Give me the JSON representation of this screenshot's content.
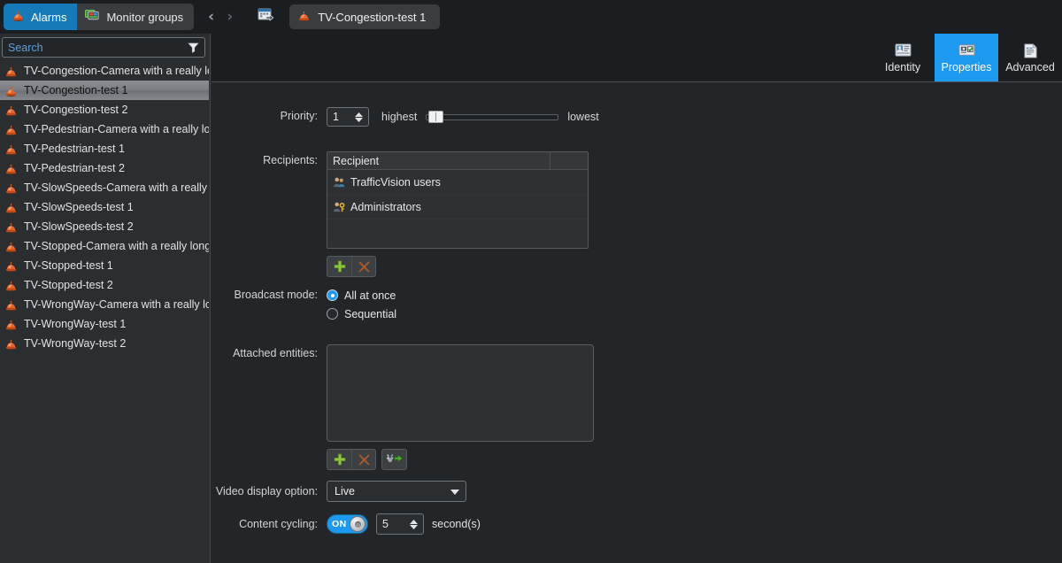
{
  "topbar": {
    "tasks": [
      {
        "label": "Alarms",
        "icon": "alarm-siren-icon",
        "active": true
      },
      {
        "label": "Monitor groups",
        "icon": "monitor-group-icon",
        "active": false
      }
    ],
    "nav": {
      "back": "‹",
      "forward": "›",
      "calendar_icon": "calendar-import-icon"
    },
    "document_tab": {
      "label": "TV-Congestion-test 1",
      "icon": "alarm-siren-icon"
    }
  },
  "sidebar": {
    "search": {
      "placeholder": "Search",
      "value": ""
    },
    "filter_icon": "filter-funnel-icon",
    "items": [
      {
        "label": "TV-Congestion-Camera with a really long",
        "icon": "alarm-siren-icon",
        "selected": false
      },
      {
        "label": "TV-Congestion-test 1",
        "icon": "alarm-siren-icon",
        "selected": true
      },
      {
        "label": "TV-Congestion-test 2",
        "icon": "alarm-siren-icon",
        "selected": false
      },
      {
        "label": "TV-Pedestrian-Camera with a really long",
        "icon": "alarm-siren-icon",
        "selected": false
      },
      {
        "label": "TV-Pedestrian-test 1",
        "icon": "alarm-siren-icon",
        "selected": false
      },
      {
        "label": "TV-Pedestrian-test 2",
        "icon": "alarm-siren-icon",
        "selected": false
      },
      {
        "label": "TV-SlowSpeeds-Camera with a really lon",
        "icon": "alarm-siren-icon",
        "selected": false
      },
      {
        "label": "TV-SlowSpeeds-test 1",
        "icon": "alarm-siren-icon",
        "selected": false
      },
      {
        "label": "TV-SlowSpeeds-test 2",
        "icon": "alarm-siren-icon",
        "selected": false
      },
      {
        "label": "TV-Stopped-Camera with a really long ca",
        "icon": "alarm-siren-icon",
        "selected": false
      },
      {
        "label": "TV-Stopped-test 1",
        "icon": "alarm-siren-icon",
        "selected": false
      },
      {
        "label": "TV-Stopped-test 2",
        "icon": "alarm-siren-icon",
        "selected": false
      },
      {
        "label": "TV-WrongWay-Camera with a really long",
        "icon": "alarm-siren-icon",
        "selected": false
      },
      {
        "label": "TV-WrongWay-test 1",
        "icon": "alarm-siren-icon",
        "selected": false
      },
      {
        "label": "TV-WrongWay-test 2",
        "icon": "alarm-siren-icon",
        "selected": false
      }
    ]
  },
  "main": {
    "tabs": [
      {
        "label": "Identity",
        "icon": "identity-card-icon",
        "active": false
      },
      {
        "label": "Properties",
        "icon": "properties-checklist-icon",
        "active": true
      },
      {
        "label": "Advanced",
        "icon": "advanced-document-icon",
        "active": false
      }
    ],
    "priority": {
      "label": "Priority:",
      "value": "1",
      "highest_label": "highest",
      "lowest_label": "lowest",
      "slider_position_percent": 0
    },
    "recipients": {
      "label": "Recipients:",
      "columns": [
        "Recipient",
        ""
      ],
      "rows": [
        {
          "name": "TrafficVision users",
          "icon": "user-group-icon"
        },
        {
          "name": "Administrators",
          "icon": "user-key-icon"
        }
      ],
      "buttons": [
        {
          "name": "add-recipient-button",
          "icon": "plus-icon"
        },
        {
          "name": "remove-recipient-button",
          "icon": "cross-icon"
        }
      ]
    },
    "broadcast_mode": {
      "label": "Broadcast mode:",
      "options": [
        {
          "label": "All at once",
          "selected": true
        },
        {
          "label": "Sequential",
          "selected": false
        }
      ]
    },
    "attached_entities": {
      "label": "Attached entities:",
      "items": [],
      "buttons": [
        {
          "name": "add-entity-button",
          "icon": "plus-icon"
        },
        {
          "name": "remove-entity-button",
          "icon": "cross-icon"
        },
        {
          "name": "configure-entity-button",
          "icon": "wrench-arrow-icon"
        }
      ]
    },
    "video_display_option": {
      "label": "Video display option:",
      "value": "Live",
      "chevron_icon": "chevron-down-icon"
    },
    "content_cycling": {
      "label": "Content cycling:",
      "toggle_state": "ON",
      "seconds": "5",
      "unit_label": "second(s)"
    }
  },
  "colors": {
    "accent_blue": "#1d99ef",
    "task_active_blue": "#1679b8",
    "panel_bg": "#232629",
    "sidebar_bg": "#2b2e31",
    "topbar_bg": "#1b1e21",
    "search_placeholder": "#5f9ed6",
    "siren_orange": "#e8652a",
    "plus_green": "#8cc63f",
    "cross_orange": "#a85a2c"
  }
}
